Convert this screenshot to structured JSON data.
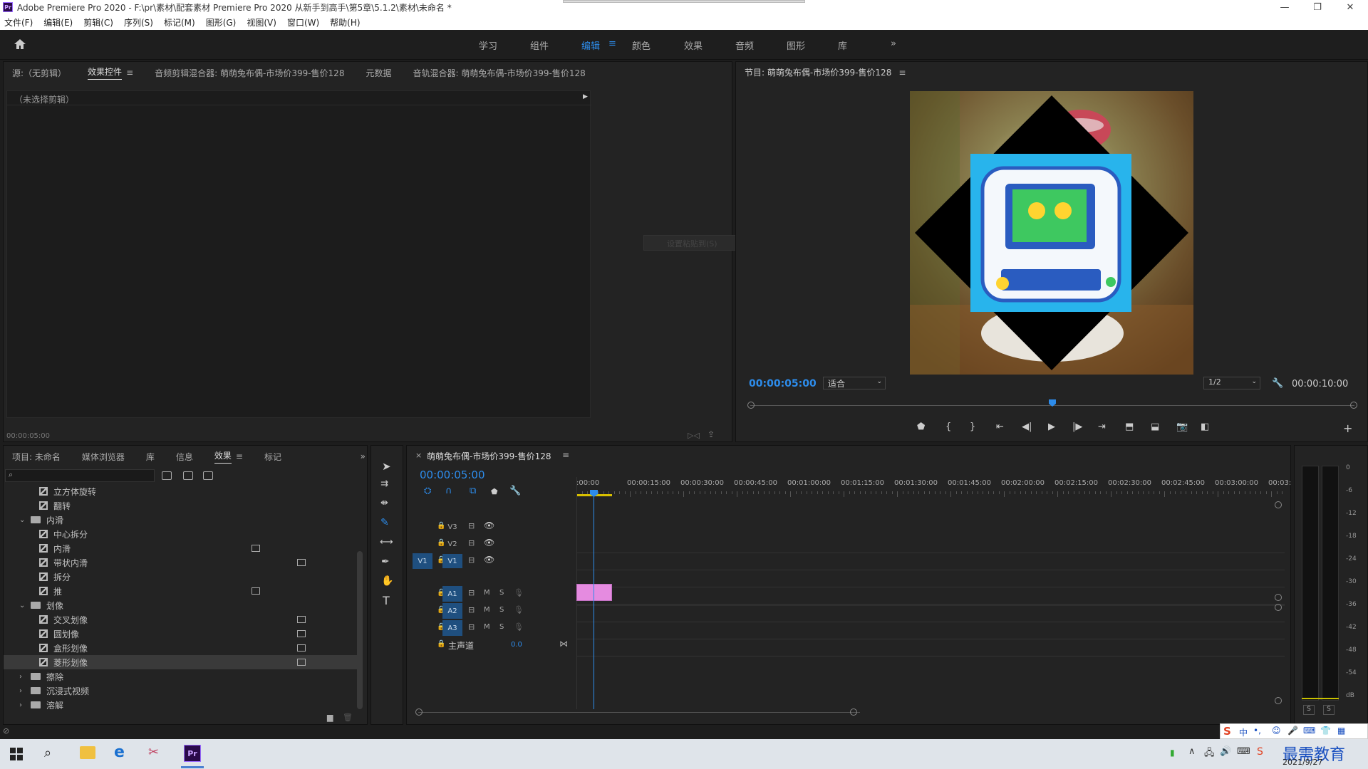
{
  "window": {
    "title": "Adobe Premiere Pro 2020 - F:\\pr\\素材\\配套素材 Premiere Pro 2020 从新手到高手\\第5章\\5.1.2\\素材\\未命名 *",
    "app_icon": "Pr"
  },
  "menu": [
    "文件(F)",
    "编辑(E)",
    "剪辑(C)",
    "序列(S)",
    "标记(M)",
    "图形(G)",
    "视图(V)",
    "窗口(W)",
    "帮助(H)"
  ],
  "workspaces": [
    "学习",
    "组件",
    "编辑",
    "颜色",
    "效果",
    "音频",
    "图形",
    "库"
  ],
  "workspace_active": "编辑",
  "source_panel": {
    "tabs": [
      "源:（无剪辑）",
      "效果控件",
      "音频剪辑混合器: 萌萌兔布偶-市场价399-售价128",
      "元数据",
      "音轨混合器: 萌萌兔布偶-市场价399-售价128"
    ],
    "active_tab": "效果控件",
    "no_clip": "（未选择剪辑）",
    "timecode": "00:00:05:00",
    "overlay_text": "设置粘贴到(S)"
  },
  "program_panel": {
    "title": "节目: 萌萌兔布偶-市场价399-售价128",
    "current_time": "00:00:05:00",
    "fit": "适合",
    "quality": "1/2",
    "duration": "00:00:10:00",
    "playhead_fraction": 0.5
  },
  "project_panel": {
    "tabs": [
      "项目: 未命名",
      "媒体浏览器",
      "库",
      "信息",
      "效果",
      "标记"
    ],
    "active_tab": "效果",
    "items": [
      {
        "label": "立方体旋转",
        "type": "effect",
        "indent": 2
      },
      {
        "label": "翻转",
        "type": "effect",
        "indent": 2
      },
      {
        "label": "内滑",
        "type": "folder",
        "indent": 1,
        "open": true
      },
      {
        "label": "中心拆分",
        "type": "effect",
        "indent": 2
      },
      {
        "label": "内滑",
        "type": "effect",
        "indent": 2,
        "badge": true
      },
      {
        "label": "带状内滑",
        "type": "effect",
        "indent": 2,
        "badge2": true
      },
      {
        "label": "拆分",
        "type": "effect",
        "indent": 2
      },
      {
        "label": "推",
        "type": "effect",
        "indent": 2,
        "badge": true
      },
      {
        "label": "划像",
        "type": "folder",
        "indent": 1,
        "open": true
      },
      {
        "label": "交叉划像",
        "type": "effect",
        "indent": 2,
        "badge2": true
      },
      {
        "label": "圆划像",
        "type": "effect",
        "indent": 2,
        "badge2": true
      },
      {
        "label": "盒形划像",
        "type": "effect",
        "indent": 2,
        "badge2": true
      },
      {
        "label": "菱形划像",
        "type": "effect",
        "indent": 2,
        "badge2": true,
        "selected": true
      },
      {
        "label": "擦除",
        "type": "folder",
        "indent": 1,
        "open": false
      },
      {
        "label": "沉浸式视频",
        "type": "folder",
        "indent": 1,
        "open": false
      },
      {
        "label": "溶解",
        "type": "folder",
        "indent": 1,
        "open": false
      }
    ]
  },
  "timeline": {
    "title": "萌萌兔布偶-市场价399-售价128",
    "timecode": "00:00:05:00",
    "ruler": [
      ":00:00",
      "00:00:15:00",
      "00:00:30:00",
      "00:00:45:00",
      "00:01:00:00",
      "00:01:15:00",
      "00:01:30:00",
      "00:01:45:00",
      "00:02:00:00",
      "00:02:15:00",
      "00:02:30:00",
      "00:02:45:00",
      "00:03:00:00",
      "00:03:"
    ],
    "video_tracks": [
      "V3",
      "V2",
      "V1"
    ],
    "audio_tracks": [
      "A1",
      "A2",
      "A3"
    ],
    "source_patch_v": "V1",
    "master": "主声道",
    "master_value": "0.0",
    "mute": "M",
    "solo": "S"
  },
  "meter": {
    "scale": [
      "0",
      "-6",
      "-12",
      "-18",
      "-24",
      "-30",
      "-36",
      "-42",
      "-48",
      "-54",
      "dB"
    ],
    "solo_buttons": [
      "S",
      "S"
    ]
  },
  "taskbar": {
    "date": "2021/9/27",
    "watermark": "最需教育",
    "ime": "中"
  },
  "colors": {
    "accent": "#2d8ceb",
    "clip": "#e58be0",
    "panel": "#232323"
  }
}
